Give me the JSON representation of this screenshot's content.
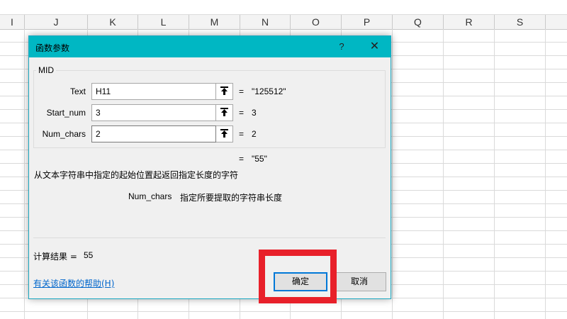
{
  "sheet": {
    "columns": [
      "I",
      "J",
      "K",
      "L",
      "M",
      "N",
      "O",
      "P",
      "Q",
      "R",
      "S"
    ]
  },
  "dialog": {
    "title": "函数参数",
    "help_symbol": "?",
    "close_symbol": "✕",
    "function_name": "MID",
    "arguments": [
      {
        "label": "Text",
        "value": "H11",
        "eq": "=",
        "result": "\"125512\""
      },
      {
        "label": "Start_num",
        "value": "3",
        "eq": "=",
        "result": "3"
      },
      {
        "label": "Num_chars",
        "value": "2",
        "eq": "=",
        "result": "2"
      }
    ],
    "formula_result_eq": "=",
    "formula_result": "\"55\"",
    "description": "从文本字符串中指定的起始位置起返回指定长度的字符",
    "param_name": "Num_chars",
    "param_description": "指定所要提取的字符串长度",
    "calc_label": "计算结果 =",
    "calc_value": "55",
    "help_link": "有关该函数的帮助(H)",
    "ok_label": "确定",
    "cancel_label": "取消"
  },
  "colors": {
    "titlebar": "#00b7c3",
    "highlight": "#e8202a",
    "link": "#0066cc",
    "ok_border": "#0078d7"
  }
}
